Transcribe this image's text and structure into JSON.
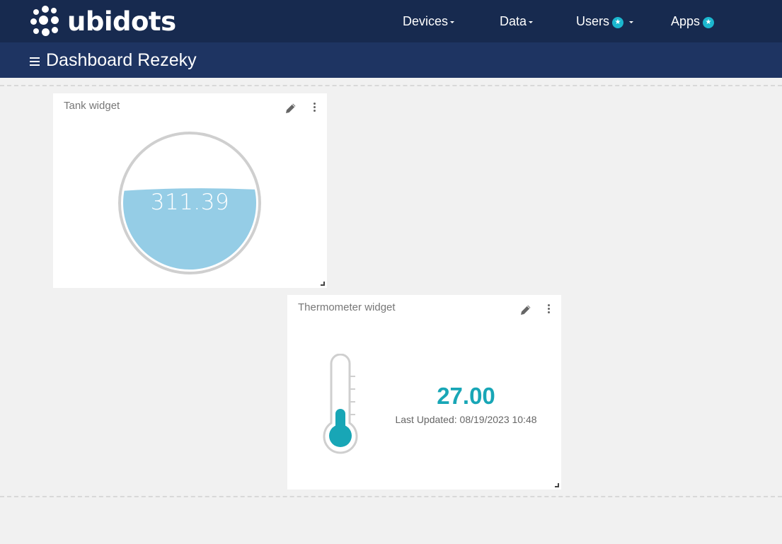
{
  "brand": {
    "name": "ubidots"
  },
  "nav": {
    "devices": "Devices",
    "data": "Data",
    "users": "Users",
    "apps": "Apps",
    "badge_icon": "star-badge-icon"
  },
  "dashboard": {
    "title": "Dashboard Rezeky",
    "menu_icon": "hamburger-icon"
  },
  "widgets": {
    "tank": {
      "title": "Tank widget",
      "value": "311.39",
      "fill_level": 0.6
    },
    "thermometer": {
      "title": "Thermometer widget",
      "value": "27.00",
      "last_updated": "Last Updated: 08/19/2023 10:48",
      "fill_level": 0.38
    }
  },
  "colors": {
    "topbar": "#172a4f",
    "subbar": "#1e3462",
    "accent": "#1bb7cf",
    "tank_fill": "#95cde6",
    "thermo_fill": "#18a6b6"
  }
}
